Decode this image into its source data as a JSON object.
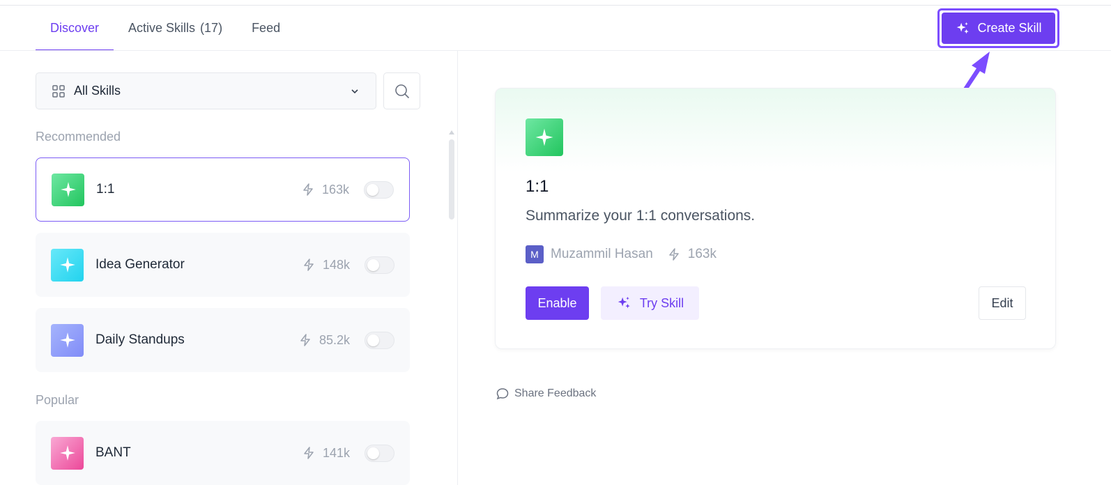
{
  "tabs": [
    {
      "label": "Discover",
      "active": true
    },
    {
      "label": "Active Skills",
      "count": "(17)"
    },
    {
      "label": "Feed"
    }
  ],
  "create_button": {
    "label": "Create Skill",
    "icon": "sparkles-icon"
  },
  "filter": {
    "label": "All Skills",
    "icon": "grid-icon"
  },
  "search": {
    "icon": "search-icon"
  },
  "sections": {
    "recommended": "Recommended",
    "popular": "Popular"
  },
  "skills": [
    {
      "name": "1:1",
      "usage": "163k",
      "enabled": false,
      "selected": true,
      "color": "#22c55e"
    },
    {
      "name": "Idea Generator",
      "usage": "148k",
      "enabled": false,
      "color": "#22d3ee"
    },
    {
      "name": "Daily Standups",
      "usage": "85.2k",
      "enabled": false,
      "color": "#818cf8"
    },
    {
      "name": "BANT",
      "usage": "141k",
      "enabled": false,
      "color": "#f472b6"
    }
  ],
  "detail": {
    "title": "1:1",
    "description": "Summarize your 1:1 conversations.",
    "author_initial": "M",
    "author": "Muzammil Hasan",
    "usage": "163k",
    "enable_label": "Enable",
    "try_label": "Try Skill",
    "edit_label": "Edit"
  },
  "feedback_label": "Share Feedback",
  "colors": {
    "accent": "#6d3ef0",
    "annotation": "#7c4dff"
  }
}
